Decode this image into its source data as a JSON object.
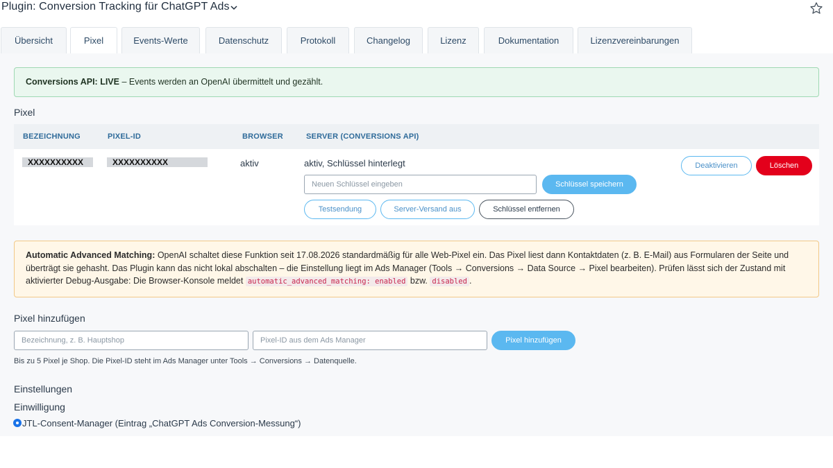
{
  "header": {
    "title": "Plugin: Conversion Tracking für ChatGPT Ads",
    "dropdown_icon": "chevron-down-icon",
    "favorite_icon": "star-outline-icon"
  },
  "tabs": [
    {
      "label": "Übersicht",
      "active": false
    },
    {
      "label": "Pixel",
      "active": true
    },
    {
      "label": "Events-Werte",
      "active": false
    },
    {
      "label": "Datenschutz",
      "active": false
    },
    {
      "label": "Protokoll",
      "active": false
    },
    {
      "label": "Changelog",
      "active": false
    },
    {
      "label": "Lizenz",
      "active": false
    },
    {
      "label": "Dokumentation",
      "active": false
    },
    {
      "label": "Lizenzvereinbarungen",
      "active": false
    }
  ],
  "status_alert": {
    "strong": "Conversions API: LIVE",
    "text": " – Events werden an OpenAI übermittelt und gezählt."
  },
  "pixel_section": {
    "title": "Pixel",
    "columns": [
      "BEZEICHNUNG",
      "PIXEL-ID",
      "BROWSER",
      "SERVER (CONVERSIONS API)"
    ],
    "row": {
      "name": "XXXXXXXXXX",
      "pixel_id": "XXXXXXXXXX",
      "browser": "aktiv",
      "server_status": "aktiv, Schlüssel hinterlegt",
      "key_placeholder": "Neuen Schlüssel eingeben",
      "save_key_label": "Schlüssel speichern",
      "test_label": "Testsendung",
      "server_off_label": "Server-Versand aus",
      "remove_key_label": "Schlüssel entfernen",
      "deactivate_label": "Deaktivieren",
      "delete_label": "Löschen"
    }
  },
  "warning_alert": {
    "strong": "Automatic Advanced Matching:",
    "line1": " OpenAI schaltet diese Funktion seit 17.08.2026 standardmäßig für alle Web-Pixel ein. Das Pixel liest dann Kontaktdaten (z. B. E-Mail) aus Formularen der Seite und",
    "line2": "überträgt sie gehasht. Das Plugin kann das nicht lokal abschalten – die Einstellung liegt im Ads Manager (Tools → Conversions → Data Source → Pixel bearbeiten). Prüfen lässt sich der Zustand mit",
    "line3_pre": "aktivierter Debug-Ausgabe: Die Browser-Konsole meldet ",
    "code1": "automatic_advanced_matching: enabled",
    "line3_mid": " bzw. ",
    "code2": "disabled",
    "line3_post": "."
  },
  "add_pixel": {
    "title": "Pixel hinzufügen",
    "name_placeholder": "Bezeichnung, z. B. Hauptshop",
    "id_placeholder": "Pixel-ID aus dem Ads Manager",
    "button_label": "Pixel hinzufügen",
    "hint": "Bis zu 5 Pixel je Shop. Die Pixel-ID steht im Ads Manager unter Tools → Conversions → Datenquelle."
  },
  "settings": {
    "title": "Einstellungen",
    "consent_title": "Einwilligung",
    "consent_option": "JTL-Consent-Manager (Eintrag „ChatGPT Ads Conversion-Messung“)",
    "consent_selected": true
  },
  "colors": {
    "primary": "#5bb8f0",
    "danger": "#e3001b",
    "success_bg": "#eaf7ef",
    "warning_bg": "#fff7e8",
    "radio": "#1a73e8"
  }
}
